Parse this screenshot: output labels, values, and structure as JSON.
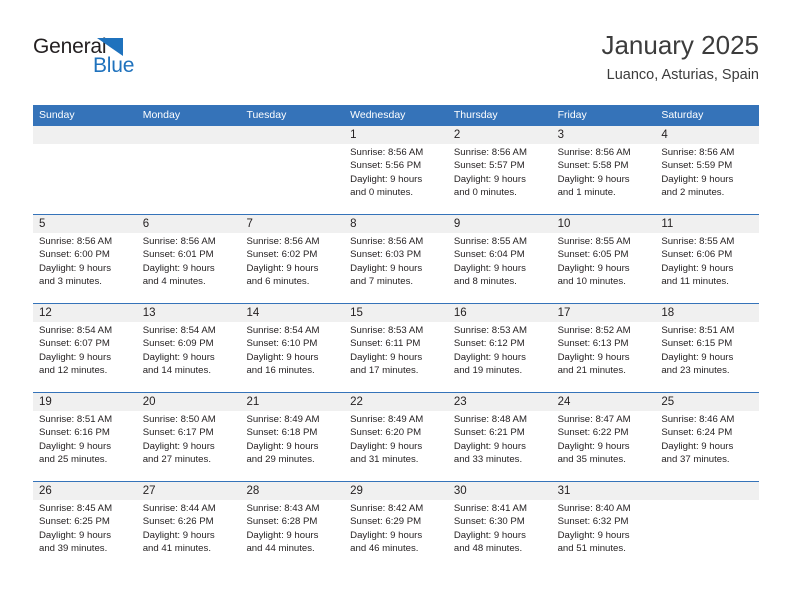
{
  "logo": {
    "word1": "General",
    "word2": "Blue",
    "triangle_color": "#1f72bd",
    "word1_color": "#231f20",
    "word2_color": "#1f72bd"
  },
  "header": {
    "title": "January 2025",
    "subtitle": "Luanco, Asturias, Spain"
  },
  "colors": {
    "header_blue": "#3573b9",
    "num_band_gray": "#f0f0f0",
    "text": "#231f20"
  },
  "weekday_headers": [
    "Sunday",
    "Monday",
    "Tuesday",
    "Wednesday",
    "Thursday",
    "Friday",
    "Saturday"
  ],
  "weeks": [
    {
      "days": [
        {
          "num": "",
          "sunrise": "",
          "sunset": "",
          "daylight1": "",
          "daylight2": ""
        },
        {
          "num": "",
          "sunrise": "",
          "sunset": "",
          "daylight1": "",
          "daylight2": ""
        },
        {
          "num": "",
          "sunrise": "",
          "sunset": "",
          "daylight1": "",
          "daylight2": ""
        },
        {
          "num": "1",
          "sunrise": "Sunrise: 8:56 AM",
          "sunset": "Sunset: 5:56 PM",
          "daylight1": "Daylight: 9 hours",
          "daylight2": "and 0 minutes."
        },
        {
          "num": "2",
          "sunrise": "Sunrise: 8:56 AM",
          "sunset": "Sunset: 5:57 PM",
          "daylight1": "Daylight: 9 hours",
          "daylight2": "and 0 minutes."
        },
        {
          "num": "3",
          "sunrise": "Sunrise: 8:56 AM",
          "sunset": "Sunset: 5:58 PM",
          "daylight1": "Daylight: 9 hours",
          "daylight2": "and 1 minute."
        },
        {
          "num": "4",
          "sunrise": "Sunrise: 8:56 AM",
          "sunset": "Sunset: 5:59 PM",
          "daylight1": "Daylight: 9 hours",
          "daylight2": "and 2 minutes."
        }
      ]
    },
    {
      "days": [
        {
          "num": "5",
          "sunrise": "Sunrise: 8:56 AM",
          "sunset": "Sunset: 6:00 PM",
          "daylight1": "Daylight: 9 hours",
          "daylight2": "and 3 minutes."
        },
        {
          "num": "6",
          "sunrise": "Sunrise: 8:56 AM",
          "sunset": "Sunset: 6:01 PM",
          "daylight1": "Daylight: 9 hours",
          "daylight2": "and 4 minutes."
        },
        {
          "num": "7",
          "sunrise": "Sunrise: 8:56 AM",
          "sunset": "Sunset: 6:02 PM",
          "daylight1": "Daylight: 9 hours",
          "daylight2": "and 6 minutes."
        },
        {
          "num": "8",
          "sunrise": "Sunrise: 8:56 AM",
          "sunset": "Sunset: 6:03 PM",
          "daylight1": "Daylight: 9 hours",
          "daylight2": "and 7 minutes."
        },
        {
          "num": "9",
          "sunrise": "Sunrise: 8:55 AM",
          "sunset": "Sunset: 6:04 PM",
          "daylight1": "Daylight: 9 hours",
          "daylight2": "and 8 minutes."
        },
        {
          "num": "10",
          "sunrise": "Sunrise: 8:55 AM",
          "sunset": "Sunset: 6:05 PM",
          "daylight1": "Daylight: 9 hours",
          "daylight2": "and 10 minutes."
        },
        {
          "num": "11",
          "sunrise": "Sunrise: 8:55 AM",
          "sunset": "Sunset: 6:06 PM",
          "daylight1": "Daylight: 9 hours",
          "daylight2": "and 11 minutes."
        }
      ]
    },
    {
      "days": [
        {
          "num": "12",
          "sunrise": "Sunrise: 8:54 AM",
          "sunset": "Sunset: 6:07 PM",
          "daylight1": "Daylight: 9 hours",
          "daylight2": "and 12 minutes."
        },
        {
          "num": "13",
          "sunrise": "Sunrise: 8:54 AM",
          "sunset": "Sunset: 6:09 PM",
          "daylight1": "Daylight: 9 hours",
          "daylight2": "and 14 minutes."
        },
        {
          "num": "14",
          "sunrise": "Sunrise: 8:54 AM",
          "sunset": "Sunset: 6:10 PM",
          "daylight1": "Daylight: 9 hours",
          "daylight2": "and 16 minutes."
        },
        {
          "num": "15",
          "sunrise": "Sunrise: 8:53 AM",
          "sunset": "Sunset: 6:11 PM",
          "daylight1": "Daylight: 9 hours",
          "daylight2": "and 17 minutes."
        },
        {
          "num": "16",
          "sunrise": "Sunrise: 8:53 AM",
          "sunset": "Sunset: 6:12 PM",
          "daylight1": "Daylight: 9 hours",
          "daylight2": "and 19 minutes."
        },
        {
          "num": "17",
          "sunrise": "Sunrise: 8:52 AM",
          "sunset": "Sunset: 6:13 PM",
          "daylight1": "Daylight: 9 hours",
          "daylight2": "and 21 minutes."
        },
        {
          "num": "18",
          "sunrise": "Sunrise: 8:51 AM",
          "sunset": "Sunset: 6:15 PM",
          "daylight1": "Daylight: 9 hours",
          "daylight2": "and 23 minutes."
        }
      ]
    },
    {
      "days": [
        {
          "num": "19",
          "sunrise": "Sunrise: 8:51 AM",
          "sunset": "Sunset: 6:16 PM",
          "daylight1": "Daylight: 9 hours",
          "daylight2": "and 25 minutes."
        },
        {
          "num": "20",
          "sunrise": "Sunrise: 8:50 AM",
          "sunset": "Sunset: 6:17 PM",
          "daylight1": "Daylight: 9 hours",
          "daylight2": "and 27 minutes."
        },
        {
          "num": "21",
          "sunrise": "Sunrise: 8:49 AM",
          "sunset": "Sunset: 6:18 PM",
          "daylight1": "Daylight: 9 hours",
          "daylight2": "and 29 minutes."
        },
        {
          "num": "22",
          "sunrise": "Sunrise: 8:49 AM",
          "sunset": "Sunset: 6:20 PM",
          "daylight1": "Daylight: 9 hours",
          "daylight2": "and 31 minutes."
        },
        {
          "num": "23",
          "sunrise": "Sunrise: 8:48 AM",
          "sunset": "Sunset: 6:21 PM",
          "daylight1": "Daylight: 9 hours",
          "daylight2": "and 33 minutes."
        },
        {
          "num": "24",
          "sunrise": "Sunrise: 8:47 AM",
          "sunset": "Sunset: 6:22 PM",
          "daylight1": "Daylight: 9 hours",
          "daylight2": "and 35 minutes."
        },
        {
          "num": "25",
          "sunrise": "Sunrise: 8:46 AM",
          "sunset": "Sunset: 6:24 PM",
          "daylight1": "Daylight: 9 hours",
          "daylight2": "and 37 minutes."
        }
      ]
    },
    {
      "days": [
        {
          "num": "26",
          "sunrise": "Sunrise: 8:45 AM",
          "sunset": "Sunset: 6:25 PM",
          "daylight1": "Daylight: 9 hours",
          "daylight2": "and 39 minutes."
        },
        {
          "num": "27",
          "sunrise": "Sunrise: 8:44 AM",
          "sunset": "Sunset: 6:26 PM",
          "daylight1": "Daylight: 9 hours",
          "daylight2": "and 41 minutes."
        },
        {
          "num": "28",
          "sunrise": "Sunrise: 8:43 AM",
          "sunset": "Sunset: 6:28 PM",
          "daylight1": "Daylight: 9 hours",
          "daylight2": "and 44 minutes."
        },
        {
          "num": "29",
          "sunrise": "Sunrise: 8:42 AM",
          "sunset": "Sunset: 6:29 PM",
          "daylight1": "Daylight: 9 hours",
          "daylight2": "and 46 minutes."
        },
        {
          "num": "30",
          "sunrise": "Sunrise: 8:41 AM",
          "sunset": "Sunset: 6:30 PM",
          "daylight1": "Daylight: 9 hours",
          "daylight2": "and 48 minutes."
        },
        {
          "num": "31",
          "sunrise": "Sunrise: 8:40 AM",
          "sunset": "Sunset: 6:32 PM",
          "daylight1": "Daylight: 9 hours",
          "daylight2": "and 51 minutes."
        },
        {
          "num": "",
          "sunrise": "",
          "sunset": "",
          "daylight1": "",
          "daylight2": ""
        }
      ]
    }
  ]
}
